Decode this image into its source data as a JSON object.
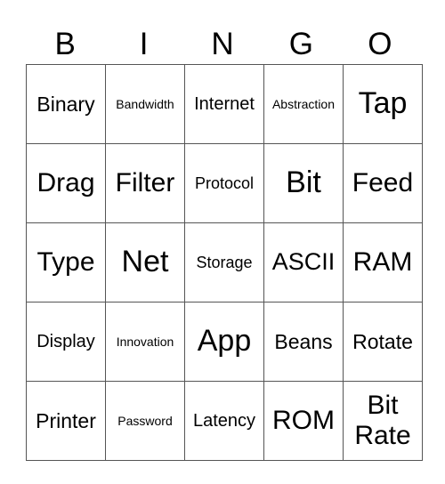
{
  "header": [
    "B",
    "I",
    "N",
    "G",
    "O"
  ],
  "rows": [
    [
      "Binary",
      "Bandwidth",
      "Internet",
      "Abstraction",
      "Tap"
    ],
    [
      "Drag",
      "Filter",
      "Protocol",
      "Bit",
      "Feed"
    ],
    [
      "Type",
      "Net",
      "Storage",
      "ASCII",
      "RAM"
    ],
    [
      "Display",
      "Innovation",
      "App",
      "Beans",
      "Rotate"
    ],
    [
      "Printer",
      "Password",
      "Latency",
      "ROM",
      "Bit Rate"
    ]
  ]
}
